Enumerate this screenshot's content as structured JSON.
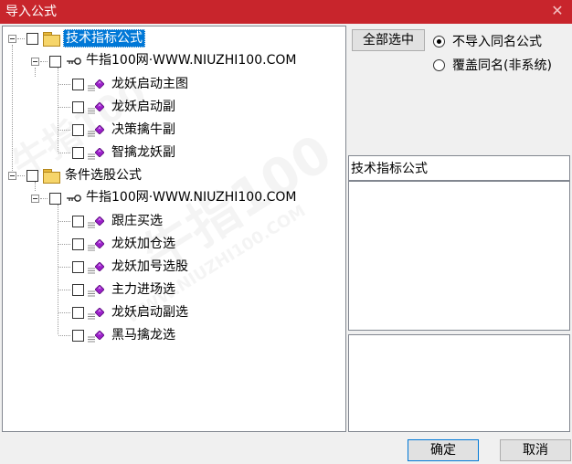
{
  "window": {
    "title": "导入公式",
    "close_glyph": "✕"
  },
  "tree": {
    "groups": [
      {
        "label": "技术指标公式",
        "selected": true,
        "publisher": "牛指100网·WWW.NIUZHI100.COM",
        "items": [
          "龙妖启动主图",
          "龙妖启动副",
          "决策擒牛副",
          "智擒龙妖副"
        ]
      },
      {
        "label": "条件选股公式",
        "selected": false,
        "publisher": "牛指100网·WWW.NIUZHI100.COM",
        "items": [
          "跟庄买选",
          "龙妖加仓选",
          "龙妖加号选股",
          "主力进场选",
          "龙妖启动副选",
          "黑马擒龙选"
        ]
      }
    ]
  },
  "watermark": {
    "text_cn": "牛指100",
    "text_url": "WWW.NIUZHI100.COM"
  },
  "options": {
    "select_all_label": "全部选中",
    "radio_skip_label": "不导入同名公式",
    "radio_overwrite_label": "覆盖同名(非系统)",
    "selected_radio": "skip"
  },
  "info_panel": {
    "category_text": "技术指标公式",
    "description_text": "",
    "extra_text": ""
  },
  "footer": {
    "ok_label": "确定",
    "cancel_label": "取消"
  },
  "colors": {
    "titlebar": "#c8252c",
    "selection": "#0078d7",
    "gem": "#9b1ec9"
  }
}
